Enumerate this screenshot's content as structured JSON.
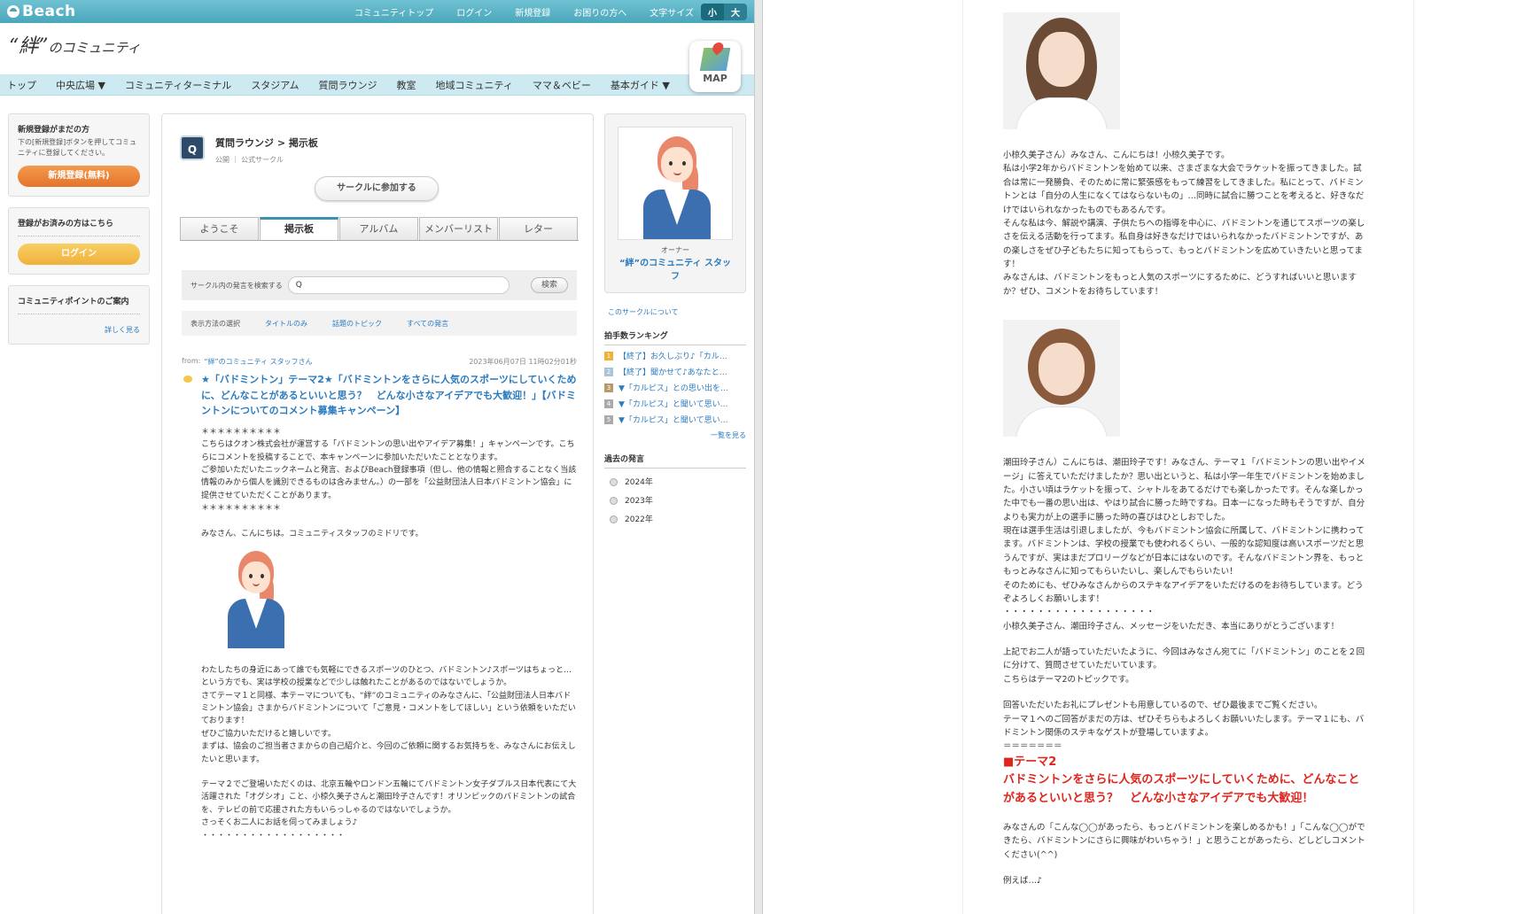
{
  "topbar": {
    "logo": "Beach",
    "links": [
      "コミュニティトップ",
      "ログイン",
      "新規登録",
      "お困りの方へ",
      "文字サイズ"
    ],
    "fontsize_small": "小",
    "fontsize_large": "大"
  },
  "header": {
    "site_logo_a": "“絆”",
    "site_logo_b": "のコミュニティ",
    "map_label": "MAP"
  },
  "nav": [
    "トップ",
    "中央広場 ▼",
    "コミュニティターミナル",
    "スタジアム",
    "質問ラウンジ",
    "教室",
    "地域コミュニティ",
    "ママ＆ベビー",
    "基本ガイド ▼"
  ],
  "left": {
    "register_title": "新規登録がまだの方",
    "register_text": "下の[新規登録]ボタンを押してコミュニティに登録してください。",
    "register_btn": "新規登録(無料)",
    "login_title": "登録がお済みの方はこちら",
    "login_btn": "ログイン",
    "points_title": "コミュニティポイントのご案内",
    "points_more": "詳しく見る"
  },
  "circle": {
    "icon": "Q",
    "title": "質問ラウンジ > 掲示板",
    "meta": "公開 ｜ 公式サークル",
    "join": "サークルに参加する",
    "tabs": [
      "ようこそ",
      "掲示板",
      "アルバム",
      "メンバーリスト",
      "レター"
    ],
    "search_label": "サークル内の発言を検索する",
    "search_value": "Q",
    "search_btn": "検索",
    "filter_label": "表示方法の選択",
    "filters": [
      "タイトルのみ",
      "話題のトピック",
      "すべての発言"
    ]
  },
  "post": {
    "from_label": "from:",
    "from_name": "“絆”のコミュニティ スタッフさん",
    "date": "2023年06月07日 11時02分01秒",
    "title": "★「バドミントン」テーマ2★「バドミントンをさらに人気のスポーツにしていくために、どんなことがあるといいと思う？　どんな小さなアイデアでも大歓迎！」【バドミントンについてのコメント募集キャンペーン】",
    "stars": "＊＊＊＊＊＊＊＊＊＊",
    "intro1": "こちらはクオン株式会社が運営する「バドミントンの思い出やアイデア募集！」キャンペーンです。こちらにコメントを投稿することで、本キャンペーンに参加いただいたこととなります。",
    "intro2": "ご参加いただいたニックネームと発言、およびBeach登録事項（但し、他の情報と照合することなく当該情報のみから個人を識別できるものは含みません。）の一部を「公益財団法人日本バドミントン協会」に提供させていただくことがあります。",
    "greeting": "みなさん、こんにちは。コミュニティスタッフのミドリです。",
    "p1": "わたしたちの身近にあって誰でも気軽にできるスポーツのひとつ、バドミントン♪スポーツはちょっと…という方でも、実は学校の授業などで少しは触れたことがあるのではないでしょうか。",
    "p2": "さてテーマ１と同様、本テーマについても、“絆”のコミュニティのみなさんに、「公益財団法人日本バドミントン協会」さまからバドミントンについて「ご意見・コメントをしてほしい」という依頼をいただいております！",
    "p3": "ぜひご協力いただけると嬉しいです。",
    "p4": "まずは、協会のご担当者さまからの自己紹介と、今回のご依頼に関するお気持ちを、みなさんにお伝えしたいと思います。",
    "p5": "テーマ２でご登場いただくのは、北京五輪やロンドン五輪にてバドミントン女子ダブルス日本代表にて大活躍された「オグシオ」こと、小椋久美子さんと潮田玲子さんです！オリンピックのバドミントンの試合を、テレビの前で応援された方もいらっしゃるのではないでしょうか。",
    "p6": "さっそくお二人にお話を伺ってみましょう♪",
    "dots": "・・・・・・・・・・・・・・・・・・"
  },
  "right": {
    "owner_label": "オーナー",
    "owner_name": "“絆”のコミュニティ スタッフ",
    "about": "このサークルについて",
    "ranking_title": "拍手数ランキング",
    "ranking": [
      "【終了】お久しぶり♪「カル…",
      "【終了】聞かせて♪あなたと…",
      "▼「カルピス」との思い出を…",
      "▼「カルピス」と聞いて思い…",
      "▼「カルピス」と聞いて思い…"
    ],
    "ranking_more": "一覧を見る",
    "past_title": "過去の発言",
    "years": [
      "2024年",
      "2023年",
      "2022年"
    ]
  },
  "article": {
    "ogura1": "小椋久美子さん）みなさん、こんにちは！小椋久美子です。",
    "ogura2": "私は小学2年からバドミントンを始めて以来、さまざまな大会でラケットを振ってきました。試合は常に一発勝負、そのために常に緊張感をもって練習をしてきました。私にとって、バドミントンとは「自分の人生になくてはならないもの」…同時に試合に勝つことを考えると、好きなだけではいられなかったものでもあるんです。",
    "ogura3": "そんな私は今、解説や講演、子供たちへの指導を中心に、バドミントンを通じてスポーツの楽しさを伝える活動を行ってます。私自身は好きなだけではいられなかったバドミントンですが、あの楽しさをぜひ子どもたちに知ってもらって、もっとバドミントンを広めていきたいと思ってます！",
    "ogura4": "みなさんは、バドミントンをもっと人気のスポーツにするために、どうすればいいと思いますか？ぜひ、コメントをお待ちしています！",
    "shiota1": "潮田玲子さん）こんにちは、潮田玲子です！みなさん、テーマ１「バドミントンの思い出やイメージ」に答えていただけましたか？思い出というと、私は小学一年生でバドミントンを始めました。小さい頃はラケットを振って、シャトルをあてるだけでも楽しかったです。そんな楽しかった中でも一番の思い出は、やはり試合に勝った時ですね。日本一になった時もそうですが、自分よりも実力が上の選手に勝った時の喜びはひとしおでした。",
    "shiota2": "現在は選手生活は引退しましたが、今もバドミントン協会に所属して、バドミントンに携わってます。バドミントンは、学校の授業でも使われるくらい、一般的な認知度は高いスポーツだと思うんですが、実はまだプロリーグなどが日本にはないのです。そんなバドミントン界を、もっともっとみなさんに知ってもらいたいし、楽しんでもらいたい！",
    "shiota3": "そのためにも、ぜひみなさんからのステキなアイデアをいただけるのをお待ちしています。どうぞよろしくお願いします！",
    "dots": "・・・・・・・・・・・・・・・・・・",
    "thanks": "小椋久美子さん、潮田玲子さん、メッセージをいただき、本当にありがとうございます！",
    "q1": "上記でお二人が語っていただいたように、今回はみなさん宛てに「バドミントン」のことを２回に分けて、質問させていただいています。",
    "q2": "こちらはテーマ2のトピックです。",
    "g1": "回答いただいたお礼にプレゼントも用意しているので、ぜひ最後までご覧ください。",
    "g2": "テーマ１へのご回答がまだの方は、ぜひそちらもよろしくお願いいたします。テーマ１にも、バドミントン関係のステキなゲストが登場していますよ。",
    "equals": "＝＝＝＝＝＝＝",
    "theme_label": "■テーマ2",
    "theme_text": "バドミントンをさらに人気のスポーツにしていくために、どんなことがあるといいと思う？　どんな小さなアイデアでも大歓迎！",
    "closing1": "みなさんの「こんな◯◯があったら、もっとバドミントンを楽しめるかも！」「こんな◯◯ができたら、バドミントンにさらに興味がわいちゃう！」と思うことがあったら、どしどしコメントください(^^)",
    "closing2": "例えば…♪"
  }
}
